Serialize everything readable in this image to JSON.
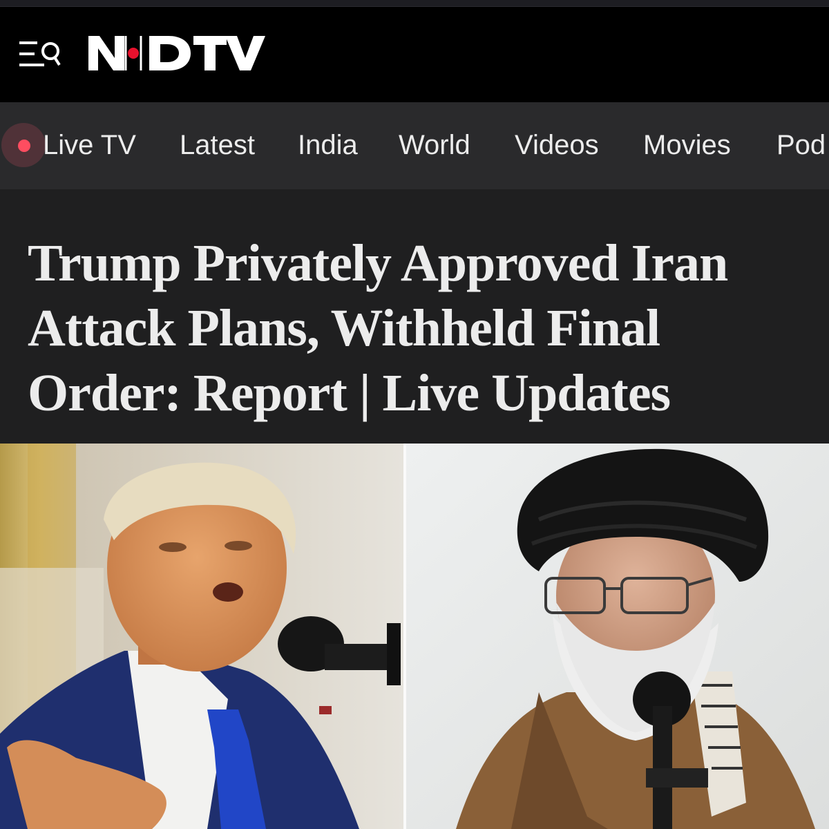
{
  "header": {
    "logo_text": "NDTV",
    "logo_dot_color": "#e8112d"
  },
  "nav": {
    "items": [
      {
        "label": "Live TV",
        "live": true
      },
      {
        "label": "Latest"
      },
      {
        "label": "India"
      },
      {
        "label": "World"
      },
      {
        "label": "Videos"
      },
      {
        "label": "Movies"
      },
      {
        "label": "Pod"
      }
    ]
  },
  "article": {
    "headline": "Trump Privately Approved Iran Attack Plans, Withheld Final Order: Report | Live Updates"
  },
  "icons": {
    "menu_search": "menu-search-icon",
    "live_indicator": "live-dot-icon"
  }
}
